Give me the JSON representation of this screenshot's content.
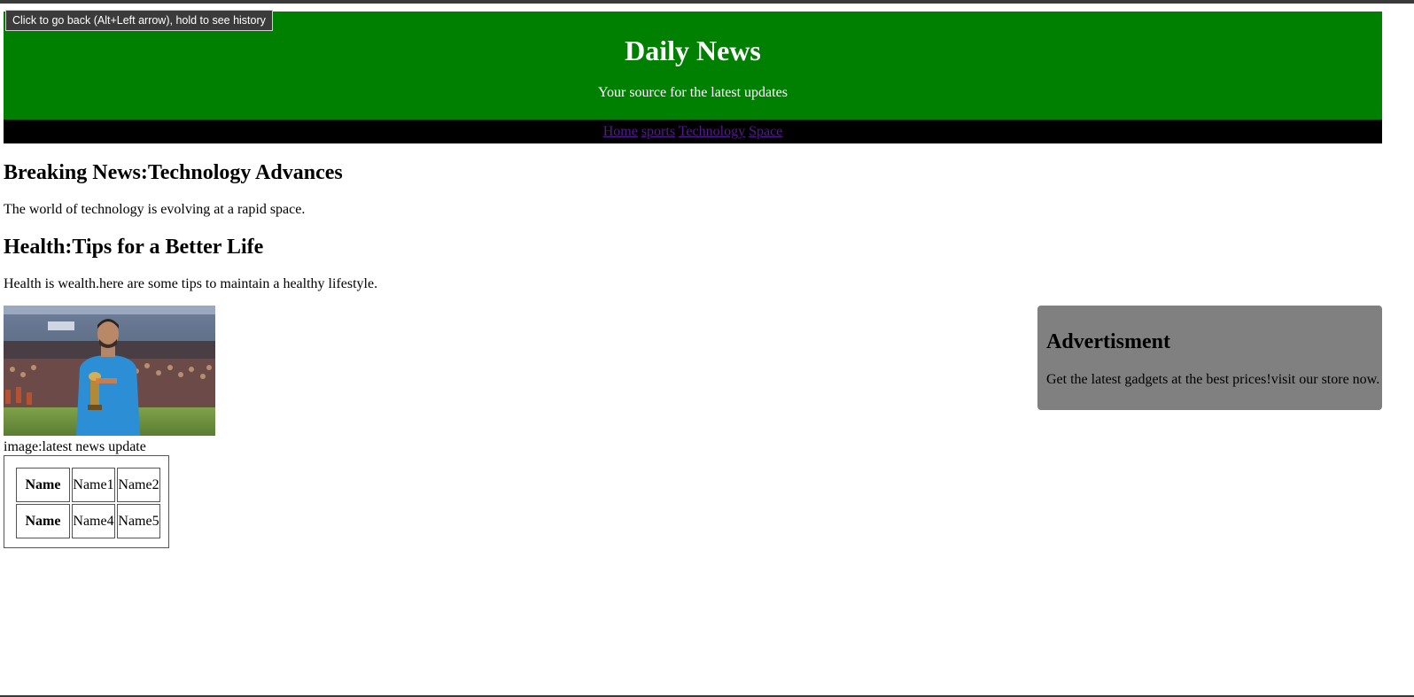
{
  "browser": {
    "back_tooltip": "Click to go back (Alt+Left arrow), hold to see history"
  },
  "header": {
    "title": "Daily News",
    "tagline": "Your source for the latest updates"
  },
  "nav": {
    "links": [
      "Home",
      "sports",
      "Technology",
      "Space"
    ]
  },
  "articles": [
    {
      "heading": "Breaking News:Technology Advances",
      "body": "The world of technology is evolving at a rapid space."
    },
    {
      "heading": "Health:Tips for a Better Life",
      "body": "Health is wealth.here are some tips to maintain a healthy lifestyle."
    }
  ],
  "media": {
    "caption": "image:latest news update"
  },
  "table": {
    "rows": [
      {
        "header": "Name",
        "cells": [
          "Name1",
          "Name2"
        ]
      },
      {
        "header": "Name",
        "cells": [
          "Name4",
          "Name5"
        ]
      }
    ]
  },
  "advert": {
    "heading": "Advertisment",
    "body": "Get the latest gadgets at the best prices!visit our store now."
  },
  "colors": {
    "header_bg": "#008000",
    "nav_bg": "#000000",
    "link": "#551a8b",
    "advert_bg": "#808080"
  }
}
